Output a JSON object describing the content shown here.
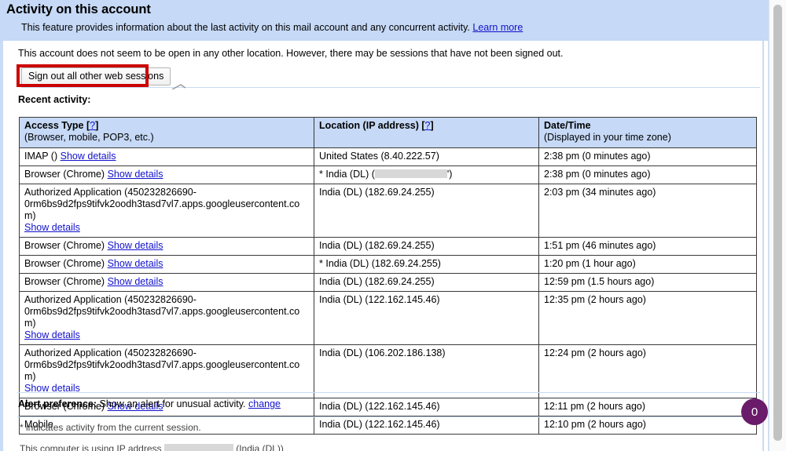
{
  "banner": {
    "title": "Activity on this account",
    "subtitle_before": "This feature provides information about the last activity on this mail account and any concurrent activity.",
    "learn_more": "Learn more"
  },
  "intro": "This account does not seem to be open in any other location. However, there may be sessions that have not been signed out.",
  "signout_button": "Sign out all other web sessions",
  "recent_label": "Recent activity:",
  "table": {
    "headers": {
      "access_type": "Access Type [",
      "access_type_q": "?",
      "access_type_close": "]",
      "access_type_sub": "(Browser, mobile, POP3, etc.)",
      "location": "Location (IP address) [",
      "location_q": "?",
      "location_close": "]",
      "datetime": "Date/Time",
      "datetime_sub": "(Displayed in your time zone)"
    },
    "show_details": "Show details",
    "oauth_client_prefix": "Authorized Application (450232826690-",
    "oauth_client_suffix": "0rm6bs9d2fps9tifvk2oodh3tasd7vl7.apps.googleusercontent.com)",
    "rows": [
      {
        "access_label": "IMAP ()",
        "has_details": true,
        "is_oauth": false,
        "location": "United States (8.40.222.57)",
        "location_star": "",
        "location_redacted": false,
        "datetime": "2:38 pm (0 minutes ago)"
      },
      {
        "access_label": "Browser (Chrome)",
        "has_details": true,
        "is_oauth": false,
        "location_star": "*",
        "location_prefix": "India (DL) (",
        "location_suffix": "')",
        "location_redacted": true,
        "datetime": "2:38 pm (0 minutes ago)"
      },
      {
        "access_label": "",
        "has_details": true,
        "is_oauth": true,
        "location": "India (DL) (182.69.24.255)",
        "location_star": "",
        "location_redacted": false,
        "datetime": "2:03 pm (34 minutes ago)"
      },
      {
        "access_label": "Browser (Chrome)",
        "has_details": true,
        "is_oauth": false,
        "location": "India (DL) (182.69.24.255)",
        "location_star": "",
        "location_redacted": false,
        "datetime": "1:51 pm (46 minutes ago)"
      },
      {
        "access_label": "Browser (Chrome)",
        "has_details": true,
        "is_oauth": false,
        "location": "India (DL) (182.69.24.255)",
        "location_star": "*",
        "location_redacted": false,
        "datetime": "1:20 pm (1 hour ago)"
      },
      {
        "access_label": "Browser (Chrome)",
        "has_details": true,
        "is_oauth": false,
        "location": "India (DL) (182.69.24.255)",
        "location_star": "",
        "location_redacted": false,
        "datetime": "12:59 pm (1.5 hours ago)"
      },
      {
        "access_label": "",
        "has_details": true,
        "is_oauth": true,
        "location": "India (DL) (122.162.145.46)",
        "location_star": "",
        "location_redacted": false,
        "datetime": "12:35 pm (2 hours ago)"
      },
      {
        "access_label": "",
        "has_details": true,
        "is_oauth": true,
        "location": "India (DL) (106.202.186.138)",
        "location_star": "",
        "location_redacted": false,
        "datetime": "12:24 pm (2 hours ago)"
      },
      {
        "access_label": "Browser (Chrome)",
        "has_details": true,
        "is_oauth": false,
        "location": "India (DL) (122.162.145.46)",
        "location_star": "",
        "location_redacted": false,
        "datetime": "12:11 pm (2 hours ago)"
      },
      {
        "access_label": "Mobile",
        "has_details": false,
        "is_oauth": false,
        "location": "India (DL) (122.162.145.46)",
        "location_star": "",
        "location_redacted": false,
        "datetime": "12:10 pm (2 hours ago)"
      }
    ]
  },
  "footer": {
    "alert_label": "Alert preference:",
    "alert_text": "Show an alert for unusual activity.",
    "alert_change": "change",
    "star_note": "* indicates activity from the current session.",
    "ip_note_prefix": "This computer is using IP address",
    "ip_note_suffix": "(India (DL))"
  },
  "badge": {
    "count": "0"
  },
  "colors": {
    "banner_bg": "#c6d9f6",
    "link": "#1111cc",
    "annotation_red": "#cc0000",
    "badge_purple": "#6a1b6a",
    "rule_blue": "#c9dbf5"
  }
}
